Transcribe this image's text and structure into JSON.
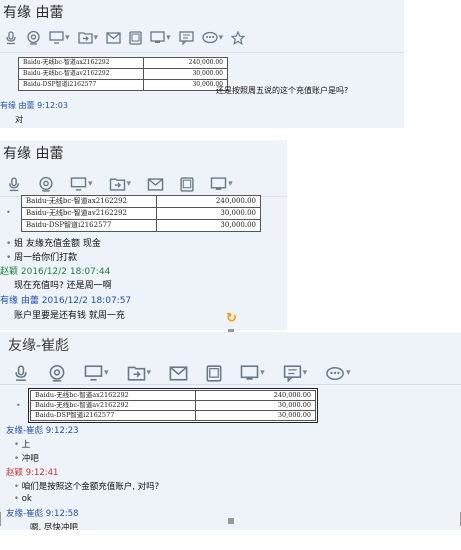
{
  "panel1": {
    "title": "有缘 由蕾",
    "rows": [
      {
        "name": "Baidu-无线bc-智道ax2162292",
        "value": "240,000.00"
      },
      {
        "name": "Baidu-无线bc-智道av2162292",
        "value": "30,000.00"
      },
      {
        "name": "Baidu-DSP智道i2162577",
        "value": "30,000.00"
      }
    ],
    "after_table_text": "还是按照周五说的这个充值账户是吗?",
    "sender": "有缘 由蕾 9:12:03",
    "reply": "对"
  },
  "panel2": {
    "title": "有缘 由蕾",
    "rows": [
      {
        "name": "Baidu-无线bc-智道ax2162292",
        "value": "240,000.00"
      },
      {
        "name": "Baidu-无线bc-智道av2162292",
        "value": "30,000.00"
      },
      {
        "name": "Baidu-DSP智道i2162577",
        "value": "30,000.00"
      }
    ],
    "line1": "姐  友缘充值金额 现金",
    "line2": "周一给你们打款",
    "sender1": "赵颖 2016/12/2 18:07:44",
    "msg1": "现在充值吗? 还是周一啊",
    "sender2": "有缘 由蕾 2016/12/2 18:07:57",
    "msg2": "账户里要是还有钱 就周一充"
  },
  "panel3": {
    "title": "友缘-崔彪",
    "rows": [
      {
        "name": "Baidu-无线bc-智道ax2162292",
        "value": "240,000.00"
      },
      {
        "name": "Baidu-无线bc-智道av2162292",
        "value": "30,000.00"
      },
      {
        "name": "Baidu-DSP智道i2162577",
        "value": "30,000.00"
      }
    ],
    "sender1": "友缘-崔彪  9:12:23",
    "msg1": "上",
    "msg2": "冲吧",
    "sender2": "赵颖  9:12:41",
    "msg3": "咱们是按照这个金额充值账户, 对吗?",
    "msg4": "ok",
    "sender3": "友缘-崔彪  9:12:58",
    "msg5": "嗯, 尽快冲吧"
  },
  "colors": {
    "panel_bg": "#eef3f9",
    "name_blue": "#1f4fb5",
    "name_green": "#22803a",
    "name_red": "#c0392b",
    "handle_orange": "#ff9900"
  },
  "icons": [
    "microphone-icon",
    "camera-icon",
    "screen-share-icon",
    "file-transfer-icon",
    "mail-icon",
    "image-icon",
    "screenshot-icon",
    "message-icon",
    "emoji-icon",
    "star-icon"
  ]
}
